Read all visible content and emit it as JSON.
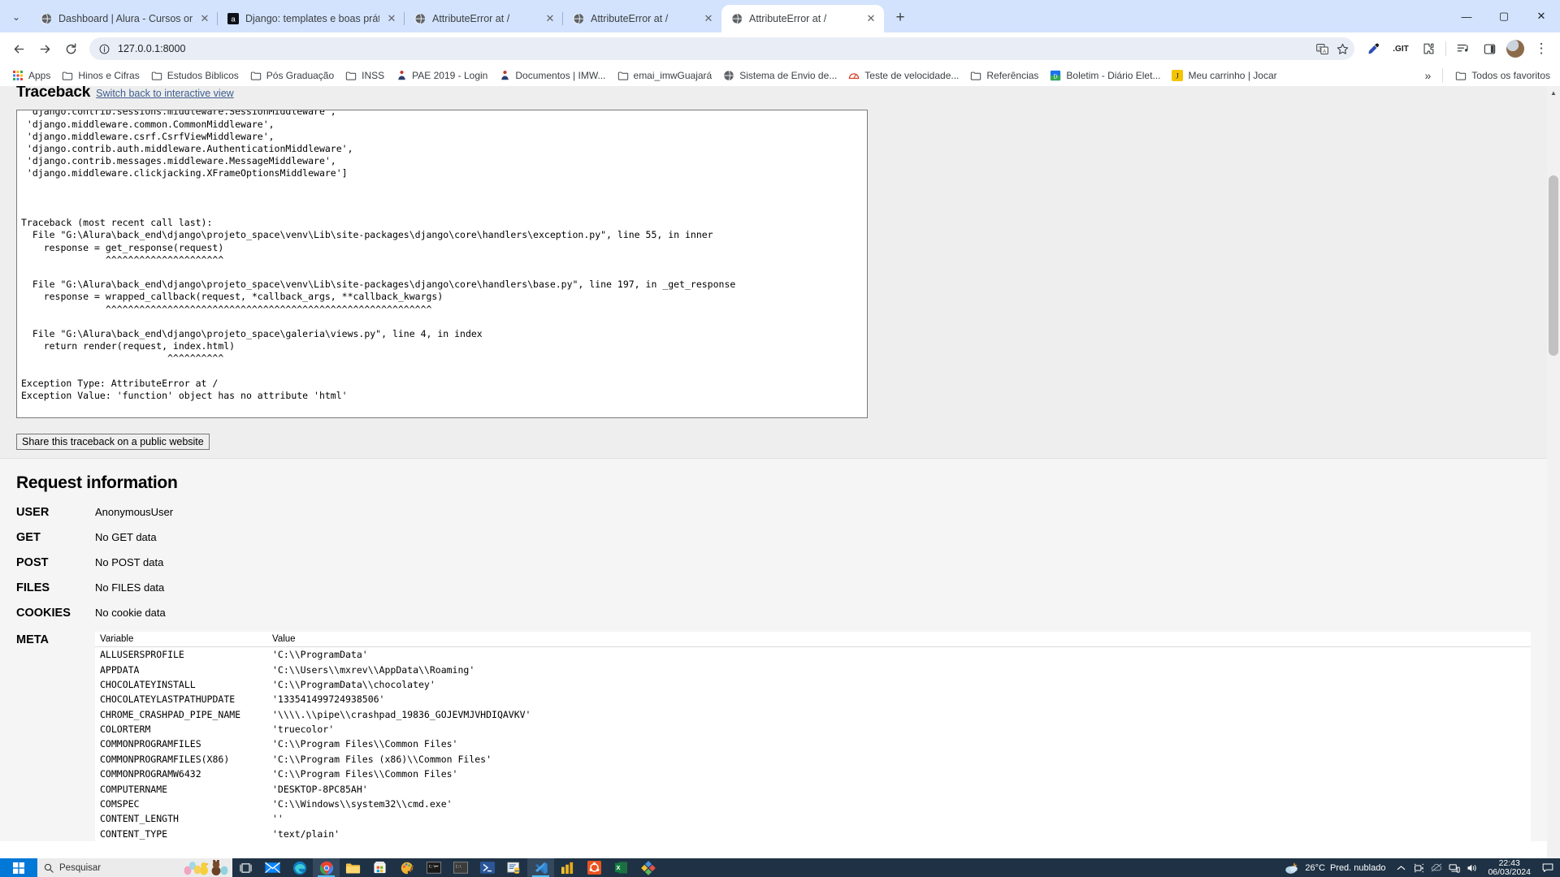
{
  "browser": {
    "tabs": [
      {
        "title": "Dashboard | Alura - Cursos onli",
        "favicon": "globe-icon",
        "active": false
      },
      {
        "title": "Django: templates e boas práti",
        "favicon": "alura-icon",
        "active": false
      },
      {
        "title": "AttributeError at /",
        "favicon": "globe-icon",
        "active": false
      },
      {
        "title": "AttributeError at /",
        "favicon": "globe-icon",
        "active": false
      },
      {
        "title": "AttributeError at /",
        "favicon": "globe-icon",
        "active": true
      }
    ],
    "new_tab_label": "+",
    "tab_close_label": "✕",
    "tab_search_label": "⌄",
    "window_controls": {
      "minimize": "—",
      "maximize": "▢",
      "close": "✕"
    },
    "nav": {
      "back": "←",
      "forward": "→",
      "reload": "⟳"
    },
    "omnibox": {
      "url": "127.0.0.1:8000",
      "site_info_icon": "info-circle-icon"
    },
    "toolbar_icons": [
      "translate-icon",
      "bookmark-star-icon",
      "eyedropper-icon",
      "git-icon",
      "extensions-icon",
      "media-list-icon",
      "side-panel-icon"
    ],
    "git_label": ".GIT",
    "menu_label": "⋮"
  },
  "bookmarks": {
    "apps_label": "Apps",
    "items": [
      {
        "label": "Hinos e Cifras",
        "icon": "folder-icon"
      },
      {
        "label": "Estudos Biblicos",
        "icon": "folder-icon"
      },
      {
        "label": "Pós Graduação",
        "icon": "folder-icon"
      },
      {
        "label": "INSS",
        "icon": "folder-icon"
      },
      {
        "label": "PAE 2019 - Login",
        "icon": "person-icon"
      },
      {
        "label": "Documentos | IMW...",
        "icon": "person-icon"
      },
      {
        "label": "emai_imwGuajará",
        "icon": "folder-icon"
      },
      {
        "label": "Sistema de Envio de...",
        "icon": "globe-icon"
      },
      {
        "label": "Teste de velocidade...",
        "icon": "speedtest-icon"
      },
      {
        "label": "Referências",
        "icon": "folder-icon"
      },
      {
        "label": "Boletim - Diário Elet...",
        "icon": "docs-icon"
      },
      {
        "label": "Meu carrinho | Jocar",
        "icon": "j-icon"
      }
    ],
    "overflow_label": "»",
    "all_bookmarks_label": "Todos os favoritos",
    "all_bookmarks_icon": "folder-icon"
  },
  "django_page": {
    "traceback_heading": "Traceback",
    "switch_link": "Switch back to interactive view",
    "traceback_text": "Installed Middleware:\n['django.middleware.security.SecurityMiddleware',\n 'django.contrib.sessions.middleware.SessionMiddleware',\n 'django.middleware.common.CommonMiddleware',\n 'django.middleware.csrf.CsrfViewMiddleware',\n 'django.contrib.auth.middleware.AuthenticationMiddleware',\n 'django.contrib.messages.middleware.MessageMiddleware',\n 'django.middleware.clickjacking.XFrameOptionsMiddleware']\n\n\n\nTraceback (most recent call last):\n  File \"G:\\Alura\\back_end\\django\\projeto_space\\venv\\Lib\\site-packages\\django\\core\\handlers\\exception.py\", line 55, in inner\n    response = get_response(request)\n               ^^^^^^^^^^^^^^^^^^^^^\n\n  File \"G:\\Alura\\back_end\\django\\projeto_space\\venv\\Lib\\site-packages\\django\\core\\handlers\\base.py\", line 197, in _get_response\n    response = wrapped_callback(request, *callback_args, **callback_kwargs)\n               ^^^^^^^^^^^^^^^^^^^^^^^^^^^^^^^^^^^^^^^^^^^^^^^^^^^^^^^^^^\n\n  File \"G:\\Alura\\back_end\\django\\projeto_space\\galeria\\views.py\", line 4, in index\n    return render(request, index.html)\n                          ^^^^^^^^^^\n\nException Type: AttributeError at /\nException Value: 'function' object has no attribute 'html'\n",
    "share_button": "Share this traceback on a public website",
    "request_info_heading": "Request information",
    "rows": [
      {
        "key": "USER",
        "value": "AnonymousUser"
      },
      {
        "key": "GET",
        "value": "No GET data"
      },
      {
        "key": "POST",
        "value": "No POST data"
      },
      {
        "key": "FILES",
        "value": "No FILES data"
      },
      {
        "key": "COOKIES",
        "value": "No cookie data"
      }
    ],
    "meta_label": "META",
    "meta_headers": {
      "variable": "Variable",
      "value": "Value"
    },
    "meta_rows": [
      {
        "variable": "ALLUSERSPROFILE",
        "value": "'C:\\\\ProgramData'"
      },
      {
        "variable": "APPDATA",
        "value": "'C:\\\\Users\\\\mxrev\\\\AppData\\\\Roaming'"
      },
      {
        "variable": "CHOCOLATEYINSTALL",
        "value": "'C:\\\\ProgramData\\\\chocolatey'"
      },
      {
        "variable": "CHOCOLATEYLASTPATHUPDATE",
        "value": "'133541499724938506'"
      },
      {
        "variable": "CHROME_CRASHPAD_PIPE_NAME",
        "value": "'\\\\\\\\.\\\\pipe\\\\crashpad_19836_GOJEVMJVHDIQAVKV'"
      },
      {
        "variable": "COLORTERM",
        "value": "'truecolor'"
      },
      {
        "variable": "COMMONPROGRAMFILES",
        "value": "'C:\\\\Program Files\\\\Common Files'"
      },
      {
        "variable": "COMMONPROGRAMFILES(X86)",
        "value": "'C:\\\\Program Files (x86)\\\\Common Files'"
      },
      {
        "variable": "COMMONPROGRAMW6432",
        "value": "'C:\\\\Program Files\\\\Common Files'"
      },
      {
        "variable": "COMPUTERNAME",
        "value": "'DESKTOP-8PC85AH'"
      },
      {
        "variable": "COMSPEC",
        "value": "'C:\\\\Windows\\\\system32\\\\cmd.exe'"
      },
      {
        "variable": "CONTENT_LENGTH",
        "value": "''"
      },
      {
        "variable": "CONTENT_TYPE",
        "value": "'text/plain'"
      }
    ]
  },
  "taskbar": {
    "search_placeholder": "Pesquisar",
    "apps": [
      "task-view-icon",
      "mail-icon",
      "edge-icon",
      "chrome-icon",
      "file-explorer-icon",
      "microsoft-store-icon",
      "paint-icon",
      "terminal-icon",
      "cmd-icon",
      "powershell-icon",
      "python-idle-icon",
      "vscode-icon",
      "power-bi-icon",
      "ubuntu-icon",
      "excel-icon",
      "kaleidoscope-icon"
    ],
    "weather_temp": "26°C",
    "weather_desc": "Pred. nublado",
    "tray_icons": [
      "chevron-up-icon",
      "camera-icon",
      "onedrive-icon",
      "network-icon",
      "volume-icon"
    ],
    "time": "22:43",
    "date": "06/03/2024",
    "notification_icon": "notification-icon"
  },
  "colors": {
    "tabstrip_bg": "#d3e3fd",
    "taskbar_bg": "#1f3245",
    "start_blue": "#0078d7",
    "link_blue": "#3e5e8f"
  }
}
